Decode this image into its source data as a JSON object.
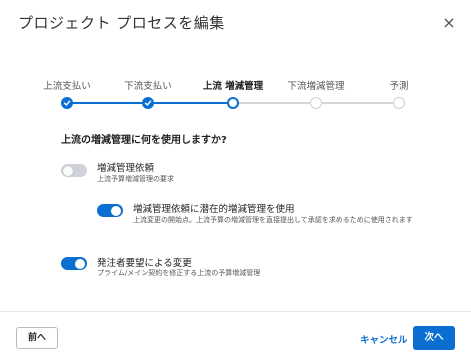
{
  "dialog": {
    "title": "プロジェクト プロセスを編集",
    "close_glyph": "×"
  },
  "steps": [
    {
      "label": "上流支払い",
      "state": "done"
    },
    {
      "label": "下流支払い",
      "state": "done"
    },
    {
      "label": "上流 増減管理",
      "state": "current"
    },
    {
      "label": "下流増減管理",
      "state": "future"
    },
    {
      "label": "予測",
      "state": "future"
    }
  ],
  "question": "上流の増減管理に何を使用しますか?",
  "options": [
    {
      "title": "増減管理依頼",
      "description": "上流予算増減管理の要求",
      "enabled": false
    },
    {
      "title": "増減管理依頼に潜在的増減管理を使用",
      "description": "上流変更の開始点。上流予算の増減管理を直接提出して承認を求めるために使用されます",
      "enabled": true
    },
    {
      "title": "発注者要望による変更",
      "description": "プライム/メイン契約を修正する上流の予算増減管理",
      "enabled": true
    }
  ],
  "footer": {
    "back_label": "前へ",
    "cancel_label": "キャンセル",
    "next_label": "次へ"
  },
  "colors": {
    "accent": "#0a6fd1",
    "inactive": "#cfcfcf"
  }
}
